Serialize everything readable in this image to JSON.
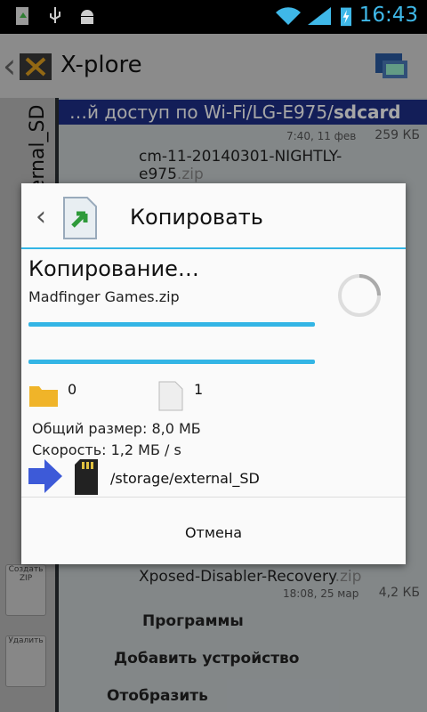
{
  "status_bar": {
    "time": "16:43"
  },
  "app": {
    "title": "X-plore"
  },
  "left_panel": {
    "vertical_label": "external_SD",
    "buttons": [
      {
        "label": "Создать ZIP"
      },
      {
        "label": "Удалить"
      }
    ]
  },
  "path_bar": {
    "text": "…й доступ по Wi-Fi/LG-E975/",
    "bold": "sdcard"
  },
  "files": [
    {
      "meta": "7:40, 11 фев",
      "size": "259 КБ"
    },
    {
      "name": "cm-11-20140301-NIGHTLY-",
      "name2": "e975",
      "ext": ".zip"
    },
    {
      "name": "Xposed-Disabler-Recovery",
      "ext": ".zip",
      "meta": "18:08, 25 мар",
      "size": "4,2 КБ"
    }
  ],
  "bottom_items": [
    {
      "label": "Программы"
    },
    {
      "label": "Добавить устройство"
    },
    {
      "label": "Отобразить"
    }
  ],
  "dialog": {
    "title": "Копировать",
    "status": "Копирование…",
    "file": "Madfinger Games.zip",
    "folders_count": "0",
    "files_count": "1",
    "total_size_label": "Общий размер:",
    "total_size_value": "8,0 МБ",
    "speed_label": "Скорость:",
    "speed_value": "1,2 МБ / s",
    "destination": "/storage/external_SD",
    "cancel_label": "Отмена"
  },
  "colors": {
    "accent": "#33b5e5",
    "path_bar": "#1e2f88"
  }
}
